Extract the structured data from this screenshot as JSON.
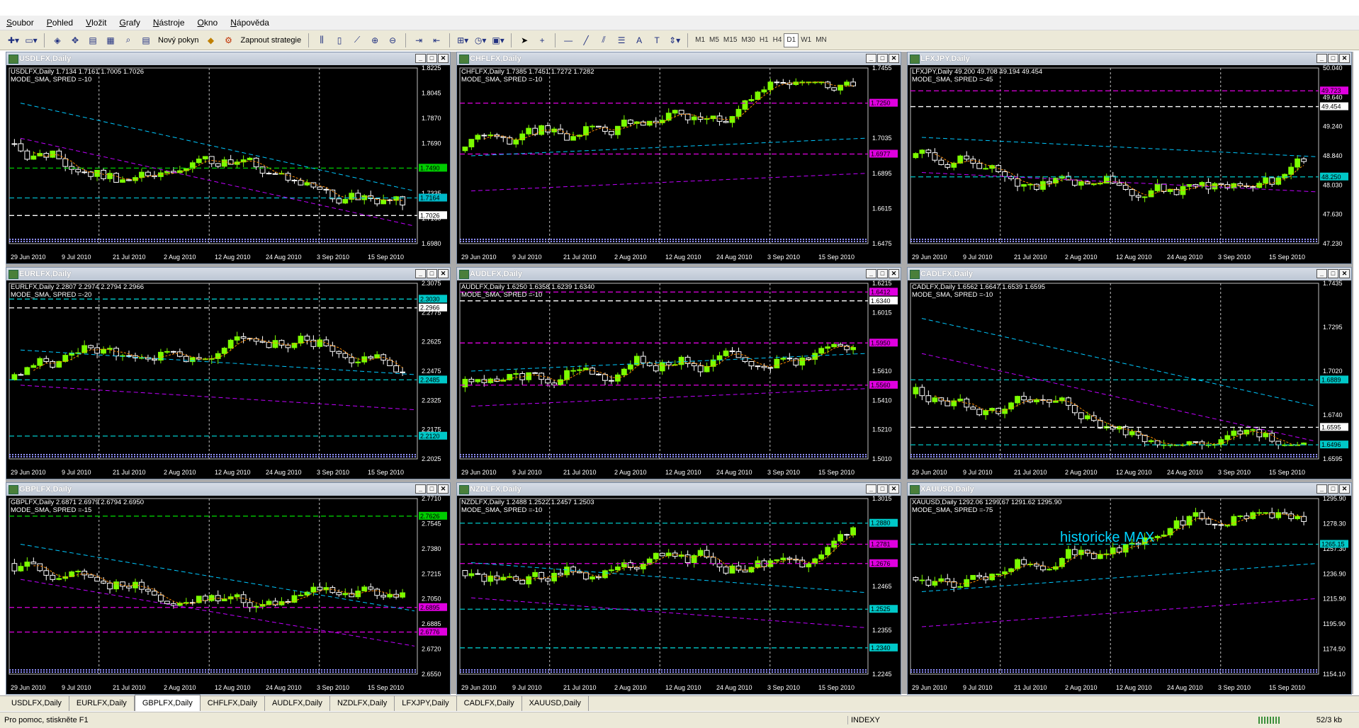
{
  "menu": [
    "Soubor",
    "Pohled",
    "Vložit",
    "Grafy",
    "Nástroje",
    "Okno",
    "Nápověda"
  ],
  "toolbar": {
    "new_order": "Nový pokyn",
    "strategy": "Zapnout strategie",
    "timeframes": [
      "M1",
      "M5",
      "M15",
      "M30",
      "H1",
      "H4",
      "D1",
      "W1",
      "MN"
    ],
    "active_timeframe": "D1"
  },
  "windows": [
    {
      "id": "usdlfx",
      "title": "USDLFX,Daily",
      "info1": "USDLFX,Daily  1.7134 1.7161 1.7005 1.7026",
      "info2": "MODE_SMA, SPRED =-10",
      "yticks": [
        "1.8225",
        "1.8045",
        "1.7870",
        "1.7690",
        "1.7515",
        "1.7335",
        "1.7160",
        "1.6980"
      ],
      "labels": [
        {
          "text": "1.7490",
          "color": "#00cc00",
          "y": 0.57
        },
        {
          "text": "1.7164",
          "color": "#00b8c8",
          "y": 0.74
        },
        {
          "text": "1.7026",
          "color": "#ffffff",
          "y": 0.84
        }
      ],
      "xlabels": [
        "29 Jun 2010",
        "9 Jul 2010",
        "21 Jul 2010",
        "2 Aug 2010",
        "12 Aug 2010",
        "24 Aug 2010",
        "3 Sep 2010",
        "15 Sep 2010"
      ]
    },
    {
      "id": "chflfx",
      "title": "CHFLFX,Daily",
      "info1": "CHFLFX,Daily  1.7385 1.7451 1.7272 1.7282",
      "info2": "MODE_SMA, SPRED =-10",
      "yticks": [
        "1.7455",
        "1.7175",
        "1.7035",
        "1.6895",
        "1.6615",
        "1.6475"
      ],
      "labels": [
        {
          "text": "1.7250",
          "color": "#e000e0",
          "y": 0.2
        },
        {
          "text": "1.6977",
          "color": "#e000e0",
          "y": 0.49
        }
      ],
      "xlabels": [
        "29 Jun 2010",
        "9 Jul 2010",
        "21 Jul 2010",
        "2 Aug 2010",
        "12 Aug 2010",
        "24 Aug 2010",
        "3 Sep 2010",
        "15 Sep 2010"
      ]
    },
    {
      "id": "lfxjpy",
      "title": "LFXJPY,Daily",
      "info1": "LFXJPY,Daily  49.200 49.708 49.194 49.454",
      "info2": "MODE_SMA, SPRED =-45",
      "yticks": [
        "50.040",
        "49.640",
        "49.240",
        "48.840",
        "48.030",
        "47.630",
        "47.230"
      ],
      "labels": [
        {
          "text": "49.723",
          "color": "#e000e0",
          "y": 0.13
        },
        {
          "text": "49.454",
          "color": "#ffffff",
          "y": 0.22
        },
        {
          "text": "48.250",
          "color": "#00c8c8",
          "y": 0.62
        }
      ],
      "xlabels": [
        "29 Jun 2010",
        "9 Jul 2010",
        "21 Jul 2010",
        "2 Aug 2010",
        "12 Aug 2010",
        "24 Aug 2010",
        "3 Sep 2010",
        "15 Sep 2010"
      ]
    },
    {
      "id": "eurlfx",
      "title": "EURLFX,Daily",
      "info1": "EURLFX,Daily  2.2807 2.2974 2.2794 2.2966",
      "info2": "MODE_SMA, SPRED =-20",
      "yticks": [
        "2.3075",
        "2.2775",
        "2.2625",
        "2.2475",
        "2.2325",
        "2.2175",
        "2.2025"
      ],
      "labels": [
        {
          "text": "2.3030",
          "color": "#00c8c8",
          "y": 0.09
        },
        {
          "text": "2.2966",
          "color": "#ffffff",
          "y": 0.14
        },
        {
          "text": "2.2485",
          "color": "#00c8c8",
          "y": 0.55
        },
        {
          "text": "2.2120",
          "color": "#00c8c8",
          "y": 0.87
        }
      ],
      "xlabels": [
        "29 Jun 2010",
        "9 Jul 2010",
        "21 Jul 2010",
        "2 Aug 2010",
        "12 Aug 2010",
        "24 Aug 2010",
        "3 Sep 2010",
        "15 Sep 2010"
      ]
    },
    {
      "id": "audlfx",
      "title": "AUDLFX,Daily",
      "info1": "AUDLFX,Daily  1.6250 1.6358 1.6239 1.6340",
      "info2": "MODE_SMA, SPRED =-10",
      "yticks": [
        "1.6215",
        "1.6015",
        "1.5815",
        "1.5610",
        "1.5410",
        "1.5210",
        "1.5010"
      ],
      "labels": [
        {
          "text": "1.6412",
          "color": "#e000e0",
          "y": 0.05
        },
        {
          "text": "1.6340",
          "color": "#ffffff",
          "y": 0.1
        },
        {
          "text": "1.5950",
          "color": "#e000e0",
          "y": 0.34
        },
        {
          "text": "1.5560",
          "color": "#e000e0",
          "y": 0.58
        }
      ],
      "xlabels": [
        "29 Jun 2010",
        "9 Jul 2010",
        "21 Jul 2010",
        "2 Aug 2010",
        "12 Aug 2010",
        "24 Aug 2010",
        "3 Sep 2010",
        "15 Sep 2010"
      ]
    },
    {
      "id": "cadlfx",
      "title": "CADLFX,Daily",
      "info1": "CADLFX,Daily  1.6562 1.6647 1.6539 1.6595",
      "info2": "MODE_SMA, SPRED =-10",
      "yticks": [
        "1.7435",
        "1.7295",
        "1.7020",
        "1.6740",
        "1.6595"
      ],
      "labels": [
        {
          "text": "1.6889",
          "color": "#00c8c8",
          "y": 0.55
        },
        {
          "text": "1.6595",
          "color": "#ffffff",
          "y": 0.82
        },
        {
          "text": "1.6496",
          "color": "#00c8c8",
          "y": 0.92
        }
      ],
      "xlabels": [
        "29 Jun 2010",
        "9 Jul 2010",
        "21 Jul 2010",
        "2 Aug 2010",
        "12 Aug 2010",
        "24 Aug 2010",
        "3 Sep 2010",
        "15 Sep 2010"
      ]
    },
    {
      "id": "gbplfx",
      "title": "GBPLFX,Daily",
      "info1": "GBPLFX,Daily  2.6871 2.6979 2.6794 2.6950",
      "info2": "MODE_SMA, SPRED =-15",
      "yticks": [
        "2.7710",
        "2.7545",
        "2.7380",
        "2.7215",
        "2.7050",
        "2.6885",
        "2.6720",
        "2.6550"
      ],
      "labels": [
        {
          "text": "2.7626",
          "color": "#00cc00",
          "y": 0.1
        },
        {
          "text": "2.6895",
          "color": "#e000e0",
          "y": 0.62
        },
        {
          "text": "2.6776",
          "color": "#e000e0",
          "y": 0.76
        }
      ],
      "xlabels": [
        "29 Jun 2010",
        "9 Jul 2010",
        "21 Jul 2010",
        "2 Aug 2010",
        "12 Aug 2010",
        "24 Aug 2010",
        "3 Sep 2010",
        "15 Sep 2010"
      ]
    },
    {
      "id": "nzdlfx",
      "title": "NZDLFX,Daily",
      "info1": "NZDLFX,Daily  1.2488 1.2522 1.2457 1.2503",
      "info2": "MODE_SMA, SPRED =-10",
      "yticks": [
        "1.3015",
        "1.2575",
        "1.2465",
        "1.2355",
        "1.2245"
      ],
      "labels": [
        {
          "text": "1.2880",
          "color": "#00c8c8",
          "y": 0.14
        },
        {
          "text": "1.2781",
          "color": "#e000e0",
          "y": 0.26
        },
        {
          "text": "1.2676",
          "color": "#e000e0",
          "y": 0.37
        },
        {
          "text": "1.2525",
          "color": "#00c8c8",
          "y": 0.63
        },
        {
          "text": "1.2340",
          "color": "#00c8c8",
          "y": 0.85
        }
      ],
      "xlabels": [
        "29 Jun 2010",
        "9 Jul 2010",
        "21 Jul 2010",
        "2 Aug 2010",
        "12 Aug 2010",
        "24 Aug 2010",
        "3 Sep 2010",
        "15 Sep 2010"
      ]
    },
    {
      "id": "xauusd",
      "title": "XAUUSD,Daily",
      "info1": "XAUUSD,Daily  1292.06 1299.67 1291.62 1295.90",
      "info2": "MODE_SMA, SPRED =-75",
      "yticks": [
        "1295.90",
        "1278.30",
        "1257.30",
        "1236.90",
        "1215.90",
        "1195.90",
        "1174.50",
        "1154.10"
      ],
      "labels": [
        {
          "text": "1265.15",
          "color": "#00c8c8",
          "y": 0.26
        }
      ],
      "overlay": "historicke  MAX",
      "xlabels": [
        "29 Jun 2010",
        "9 Jul 2010",
        "21 Jul 2010",
        "2 Aug 2010",
        "12 Aug 2010",
        "24 Aug 2010",
        "3 Sep 2010",
        "15 Sep 2010"
      ]
    }
  ],
  "tabs": [
    "USDLFX,Daily",
    "EURLFX,Daily",
    "GBPLFX,Daily",
    "CHFLFX,Daily",
    "AUDLFX,Daily",
    "NZDLFX,Daily",
    "LFXJPY,Daily",
    "CADLFX,Daily",
    "XAUUSD,Daily"
  ],
  "active_tab": "GBPLFX,Daily",
  "status": {
    "help": "Pro pomoc, stiskněte F1",
    "profile": "INDEXY",
    "traffic": "52/3 kb"
  },
  "colors": {
    "bull": "#7cfc00",
    "bear": "#ffffff",
    "background": "#000000"
  }
}
